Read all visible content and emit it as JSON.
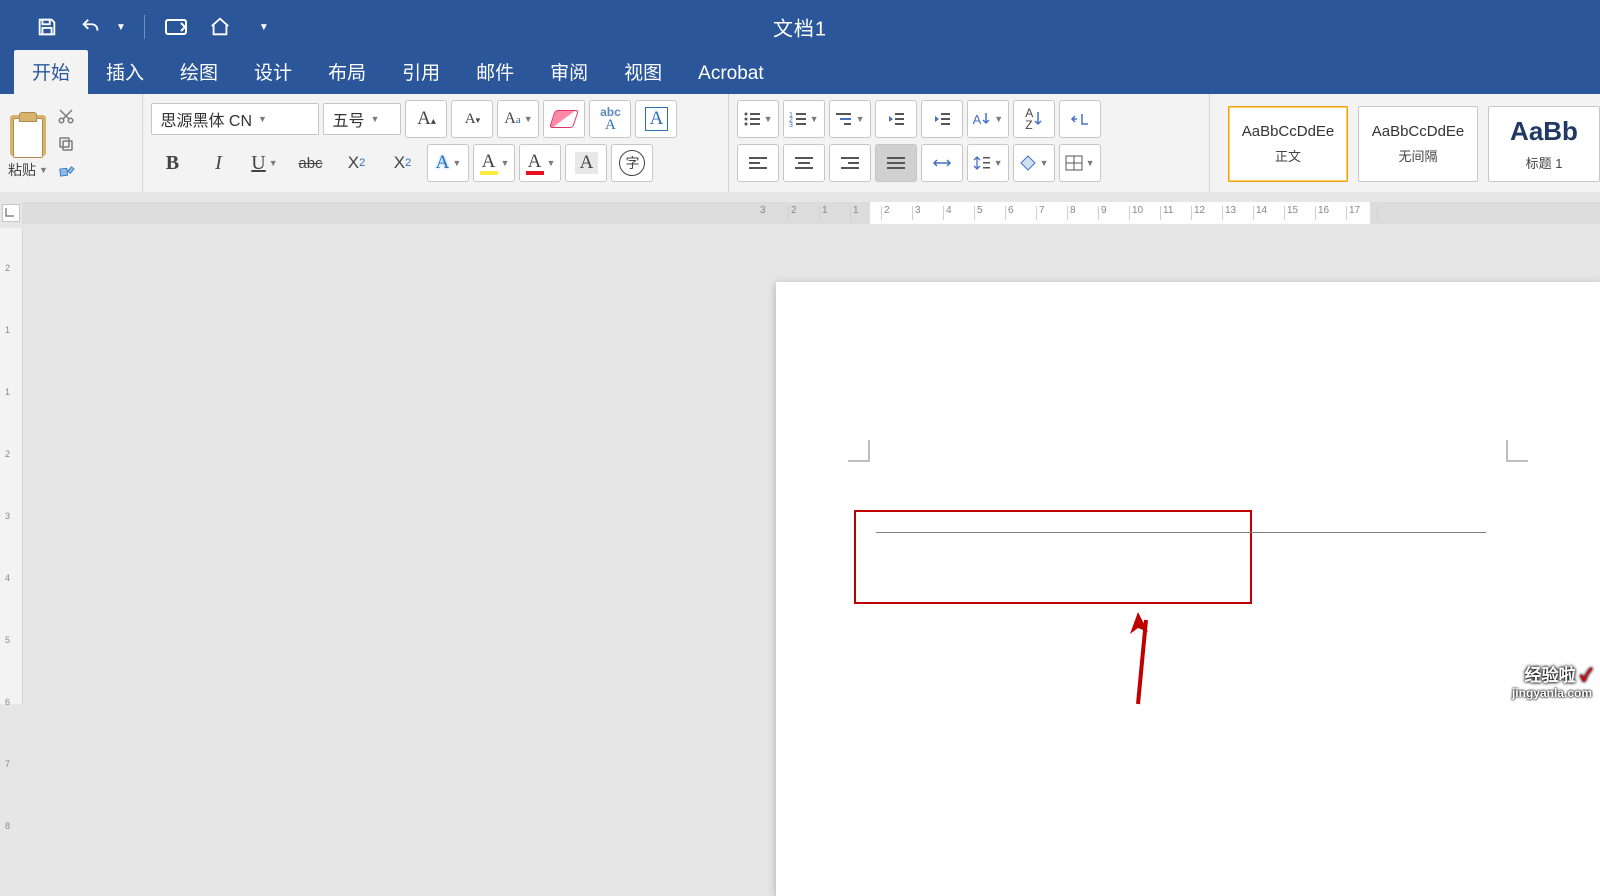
{
  "title": "文档1",
  "qat": {
    "save": "save",
    "undo": "undo",
    "touch": "touch-mode",
    "home": "home",
    "more": "customize"
  },
  "tabs": [
    "开始",
    "插入",
    "绘图",
    "设计",
    "布局",
    "引用",
    "邮件",
    "审阅",
    "视图",
    "Acrobat"
  ],
  "active_tab": 0,
  "clipboard": {
    "paste": "粘贴"
  },
  "font": {
    "name": "思源黑体 CN",
    "size": "五号",
    "grow": "A",
    "shrink": "A",
    "changecase": "Aa",
    "clear": "清除",
    "phonetic": "abc",
    "charborder": "A",
    "bold": "B",
    "italic": "I",
    "underline": "U",
    "strike": "abc",
    "sub": "X",
    "sup": "X",
    "texteffect": "A",
    "highlight": "A",
    "fontcolor": "A",
    "charshade": "A",
    "enclose": "字"
  },
  "paragraph": {
    "bullets": "•",
    "numbering": "1",
    "multilevel": "≡",
    "dec": "←",
    "inc": "→",
    "sort": "A↓Z",
    "showmarks": "¶",
    "alignL": "L",
    "alignC": "C",
    "alignR": "R",
    "alignJ": "J",
    "alignD": "D",
    "linespace": "↕",
    "shading": "▢",
    "borders": "▦"
  },
  "styles": [
    {
      "sample": "AaBbCcDdEe",
      "name": "正文",
      "selected": true
    },
    {
      "sample": "AaBbCcDdEe",
      "name": "无间隔",
      "selected": false
    },
    {
      "sample": "AaBb",
      "name": "标题 1",
      "selected": false,
      "big": true
    }
  ],
  "ruler_numbers": [
    3,
    2,
    1,
    1,
    2,
    3,
    4,
    5,
    6,
    7,
    8,
    9,
    10,
    11,
    12,
    13,
    14,
    15,
    16,
    17
  ],
  "vruler_numbers": [
    2,
    1,
    1,
    2,
    3,
    4,
    5,
    6,
    7,
    8
  ],
  "watermark": {
    "line1": "经验啦",
    "check": "✓",
    "line2": "jingyanla.com"
  }
}
